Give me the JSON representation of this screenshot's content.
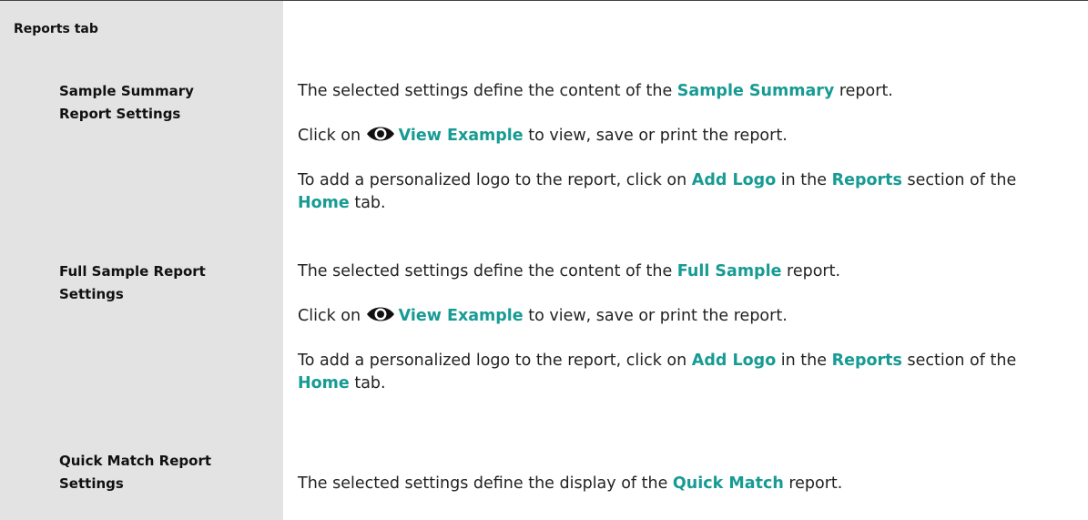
{
  "colors": {
    "highlight": "#179b93",
    "sidebar": "#e3e3e3"
  },
  "heading": "Reports tab",
  "sample_summary": {
    "label_line1": "Sample Summary",
    "label_line2": "Report Settings",
    "p1": {
      "before": "The selected settings define the content of the ",
      "highlight": "Sample Summary",
      "after": " report."
    },
    "p2": {
      "before": "Click on ",
      "icon": "eye-icon",
      "highlight": "View Example",
      "after": " to view, save or print the report."
    },
    "p3": {
      "before": "To add a personalized logo to the report, click on ",
      "hl1": "Add Logo",
      "mid1": " in the ",
      "hl2": "Reports",
      "mid2": " section of the ",
      "hl3": "Home",
      "after": " tab."
    }
  },
  "full_sample": {
    "label_line1": "Full Sample Report",
    "label_line2": "Settings",
    "p1": {
      "before": "The selected settings define the content of the ",
      "highlight": "Full Sample",
      "after": " report."
    },
    "p2": {
      "before": "Click on ",
      "icon": "eye-icon",
      "highlight": "View Example",
      "after": " to view, save or print the report."
    },
    "p3": {
      "before": "To add a personalized logo to the report, click on ",
      "hl1": "Add Logo",
      "mid1": " in the ",
      "hl2": "Reports",
      "mid2": " section of the ",
      "hl3": "Home",
      "after": " tab."
    }
  },
  "quick_match": {
    "label_line1": "Quick Match Report",
    "label_line2": "Settings",
    "p1": {
      "before": "The selected settings define the display of the ",
      "highlight": "Quick Match",
      "after": " report."
    }
  }
}
